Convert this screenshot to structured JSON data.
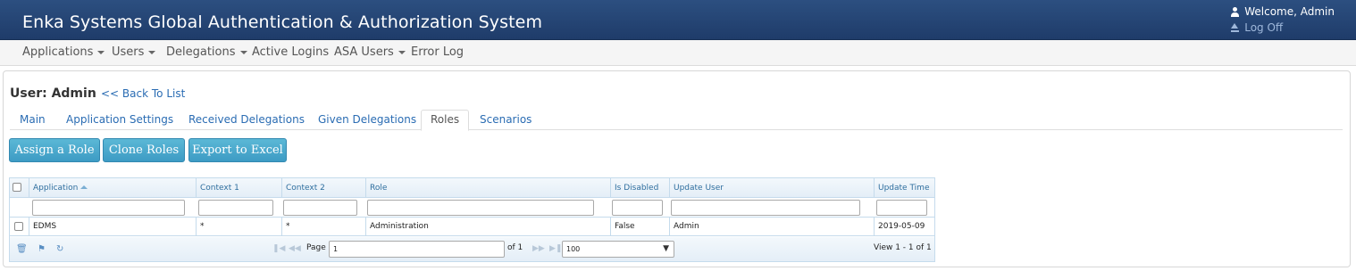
{
  "header": {
    "title": "Enka Systems Global Authentication & Authorization System",
    "welcome": "Welcome, Admin",
    "logoff": "Log Off"
  },
  "nav": {
    "items": [
      {
        "label": "Applications",
        "dropdown": true
      },
      {
        "label": "Users",
        "dropdown": true
      },
      {
        "label": "Delegations",
        "dropdown": true
      },
      {
        "label": "Active Logins",
        "dropdown": false
      },
      {
        "label": "ASA Users",
        "dropdown": true
      },
      {
        "label": "Error Log",
        "dropdown": false
      }
    ]
  },
  "page": {
    "title": "User: Admin",
    "back_link": "<< Back To List"
  },
  "tabs": [
    {
      "label": "Main"
    },
    {
      "label": "Application Settings"
    },
    {
      "label": "Received Delegations"
    },
    {
      "label": "Given Delegations"
    },
    {
      "label": "Roles",
      "active": true
    },
    {
      "label": "Scenarios"
    }
  ],
  "toolbar": {
    "assign_role": "Assign a Role",
    "clone_roles": "Clone Roles",
    "export_excel": "Export to Excel"
  },
  "grid": {
    "columns": [
      "Application",
      "Context 1",
      "Context 2",
      "Role",
      "Is Disabled",
      "Update User",
      "Update Time"
    ],
    "sort_column": "Application",
    "rows": [
      [
        "EDMS",
        "*",
        "*",
        "Administration",
        "False",
        "Admin",
        "2019-05-09"
      ]
    ],
    "pager": {
      "page_label": "Page",
      "page_value": "1",
      "of_label": "of 1",
      "page_size": "100",
      "view_text": "View 1 - 1 of 1"
    }
  },
  "colors": {
    "header_bg": "#2c4f80",
    "link": "#2a6cb3",
    "button": "#4aa8cf"
  }
}
